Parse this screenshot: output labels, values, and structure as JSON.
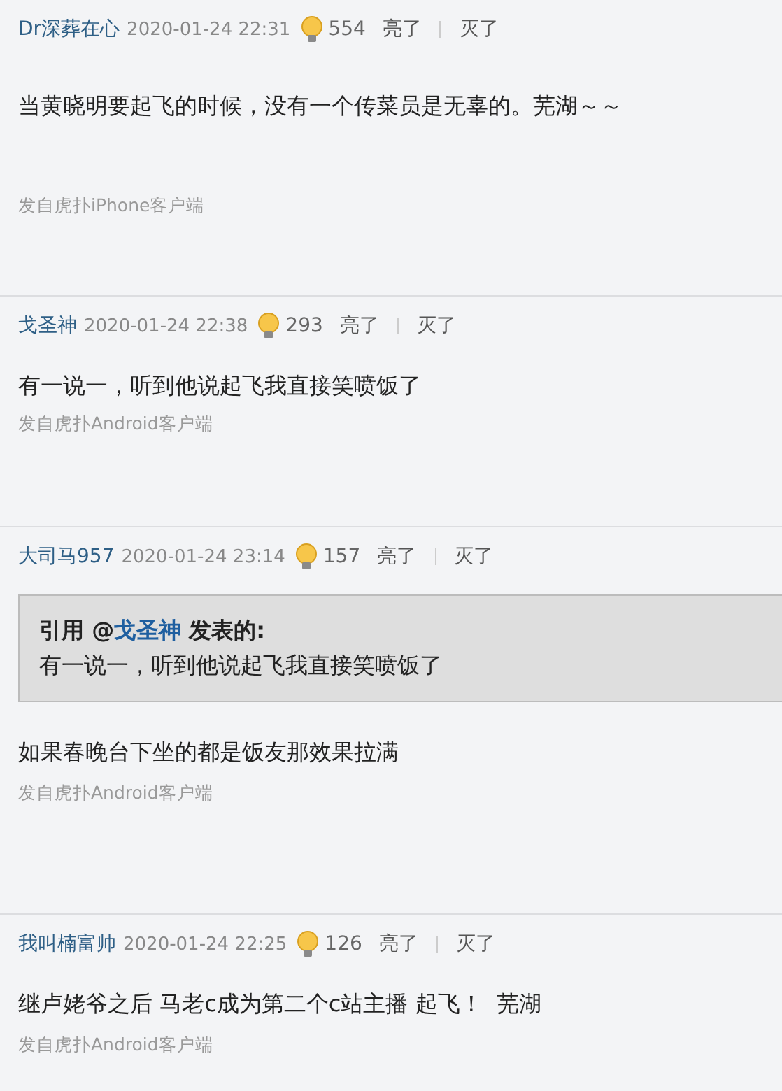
{
  "comments": [
    {
      "user": "Dr深葬在心",
      "time": "2020-01-24 22:31",
      "likes": "554",
      "light_label": "亮了",
      "dark_label": "灭了",
      "body": "当黄晓明要起飞的时候，没有一个传菜员是无辜的。芜湖～～",
      "source": "发自虎扑iPhone客户端"
    },
    {
      "user": "戈圣神",
      "time": "2020-01-24 22:38",
      "likes": "293",
      "light_label": "亮了",
      "dark_label": "灭了",
      "body": "有一说一，听到他说起飞我直接笑喷饭了",
      "source": "发自虎扑Android客户端"
    },
    {
      "user": "大司马957",
      "time": "2020-01-24 23:14",
      "likes": "157",
      "light_label": "亮了",
      "dark_label": "灭了",
      "quote": {
        "before": "引用 @",
        "author": "戈圣神",
        "after": "发表的:",
        "text": "有一说一，听到他说起飞我直接笑喷饭了"
      },
      "body": "如果春晚台下坐的都是饭友那效果拉满",
      "source": "发自虎扑Android客户端"
    },
    {
      "user": "我叫楠富帅",
      "time": "2020-01-24 22:25",
      "likes": "126",
      "light_label": "亮了",
      "dark_label": "灭了",
      "body": "继卢姥爷之后 马老c成为第二个c站主播 起飞！  芜湖",
      "source": "发自虎扑Android客户端"
    }
  ]
}
